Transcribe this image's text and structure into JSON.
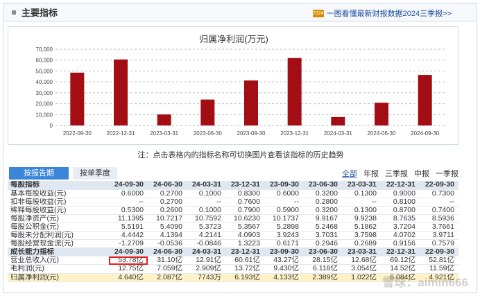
{
  "header": {
    "title": "主要指标",
    "promo_icon": "2024",
    "promo_link": "一图看懂最新财报数据2024三季报>>"
  },
  "chart_data": {
    "type": "bar",
    "title": "归属净利润(万元)",
    "categories": [
      "2022-09-30",
      "2022-12-31",
      "2023-03-31",
      "2023-06-30",
      "2023-09-30",
      "2023-12-31",
      "2024-03-31",
      "2024-06-30",
      "2024-09-30"
    ],
    "values": [
      48500,
      60600,
      10100,
      23800,
      41300,
      61900,
      7743,
      20900,
      46400
    ],
    "yticks": [
      "0",
      "10,000",
      "20,000",
      "30,000",
      "40,000",
      "50,000",
      "60,000",
      "70,000"
    ],
    "ylim": [
      0,
      70000
    ],
    "grid": true,
    "bar_color": "#a30d14"
  },
  "note": "注：点击表格内的指标名称可切换图片查看该指标的历史趋势",
  "tabs": {
    "active": "按报告期",
    "inactive": "按单季度"
  },
  "filters": [
    "全部",
    "年报",
    "三季报",
    "中报",
    "一季报"
  ],
  "table": {
    "periods": [
      "24-09-30",
      "24-06-30",
      "24-03-31",
      "23-12-31",
      "23-09-30",
      "23-06-30",
      "23-03-31",
      "22-12-31",
      "22-09-30"
    ],
    "sections": [
      {
        "title": "每股指标",
        "rows": [
          {
            "label": "基本每股收益(元)",
            "values": [
              "0.6000",
              "0.2700",
              "0.1000",
              "0.8300",
              "0.6000",
              "0.3200",
              "0.1300",
              "0.9000",
              "0.7300"
            ]
          },
          {
            "label": "扣非每股收益(元)",
            "values": [
              "--",
              "0.2700",
              "--",
              "0.7600",
              "--",
              "0.2800",
              "--",
              "0.8100",
              "--"
            ]
          },
          {
            "label": "稀释每股收益(元)",
            "values": [
              "0.5300",
              "0.2600",
              "0.1000",
              "0.7900",
              "0.5900",
              "0.3200",
              "0.1300",
              "0.8700",
              "0.7400"
            ]
          },
          {
            "label": "每股净资产(元)",
            "values": [
              "11.1395",
              "10.7217",
              "10.7592",
              "10.6230",
              "10.1737",
              "9.9167",
              "9.9238",
              "8.7635",
              "8.5936"
            ]
          },
          {
            "label": "每股公积金(元)",
            "values": [
              "5.5191",
              "5.4090",
              "5.3723",
              "5.3567",
              "5.2898",
              "5.2468",
              "5.1862",
              "3.7204",
              "3.7661"
            ]
          },
          {
            "label": "每股未分配利润(元)",
            "values": [
              "4.4442",
              "4.1394",
              "4.2141",
              "4.0903",
              "3.9243",
              "3.7031",
              "3.7598",
              "4.0702",
              "3.9711"
            ]
          },
          {
            "label": "每股经营现金流(元)",
            "values": [
              "-1.2709",
              "-0.0536",
              "-0.0846",
              "1.3223",
              "0.6171",
              "0.2946",
              "0.2689",
              "0.9156",
              "0.7579"
            ]
          }
        ]
      },
      {
        "title": "成长能力指标",
        "rows": [
          {
            "label": "营业总收入(元)",
            "values": [
              "53.78亿",
              "31.10亿",
              "12.91亿",
              "60.61亿",
              "43.27亿",
              "28.15亿",
              "12.68亿",
              "69.12亿",
              "52.81亿"
            ]
          },
          {
            "label": "毛利润(元)",
            "values": [
              "12.75亿",
              "7.059亿",
              "2.909亿",
              "13.72亿",
              "9.430亿",
              "6.118亿",
              "3.054亿",
              "14.52亿",
              "11.59亿"
            ]
          },
          {
            "label": "归属净利润(元)",
            "values": [
              "4.640亿",
              "2.087亿",
              "7743万",
              "6.193亿",
              "4.133亿",
              "2.389亿",
              "1.022亿",
              "6.084亿",
              "4.921亿"
            ]
          }
        ]
      }
    ]
  },
  "watermark": "雪球：aimin666"
}
